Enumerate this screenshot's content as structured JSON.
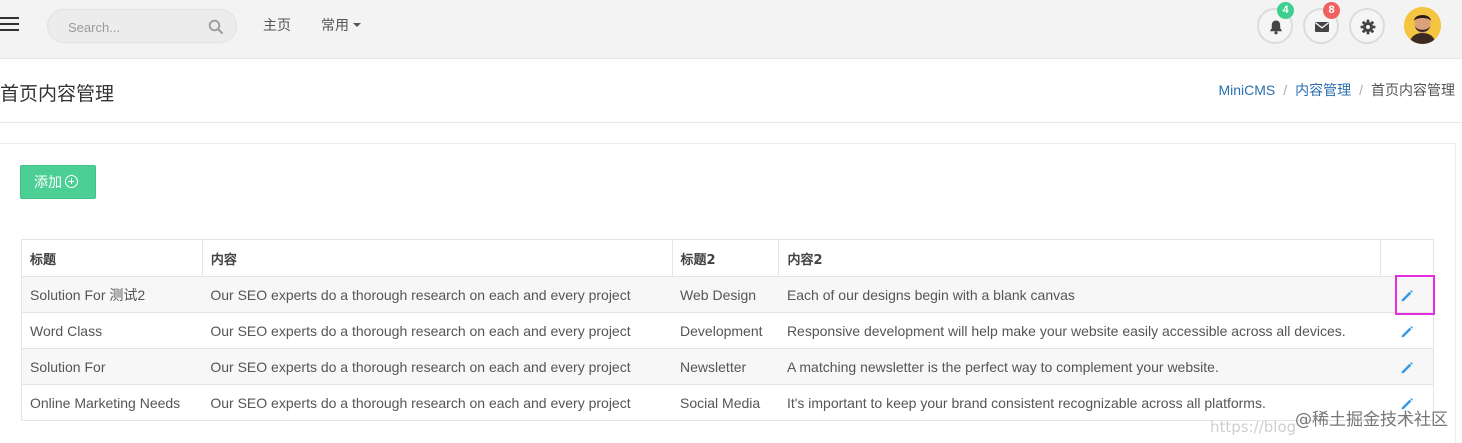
{
  "navbar": {
    "search_placeholder": "Search...",
    "links": {
      "home": "主页",
      "common": "常用"
    },
    "notifications_count": "4",
    "messages_count": "8"
  },
  "page": {
    "title": "首页内容管理",
    "breadcrumb": [
      "MiniCMS",
      "内容管理",
      "首页内容管理"
    ]
  },
  "toolbar": {
    "add_label": "添加"
  },
  "table": {
    "headers": [
      "标题",
      "内容",
      "标题2",
      "内容2"
    ],
    "rows": [
      [
        "Solution For 测试2",
        "Our SEO experts do a thorough research on each and every project",
        "Web Design",
        "Each of our designs begin with a blank canvas"
      ],
      [
        "Word Class",
        "Our SEO experts do a thorough research on each and every project",
        "Development",
        "Responsive development will help make your website easily accessible across all devices."
      ],
      [
        "Solution For",
        "Our SEO experts do a thorough research on each and every project",
        "Newsletter",
        "A matching newsletter is the perfect way to complement your website."
      ],
      [
        "Online Marketing Needs",
        "Our SEO experts do a thorough research on each and every project",
        "Social Media",
        "It's important to keep your brand consistent recognizable across all platforms."
      ]
    ]
  },
  "watermark": {
    "text": "@稀土掘金技术社区",
    "url_fragment": "https://blog"
  },
  "colors": {
    "accent_green": "#4ccf94",
    "link_blue": "#2a6fae",
    "edit_blue": "#3a9be0",
    "highlight": "#e62ce0"
  }
}
